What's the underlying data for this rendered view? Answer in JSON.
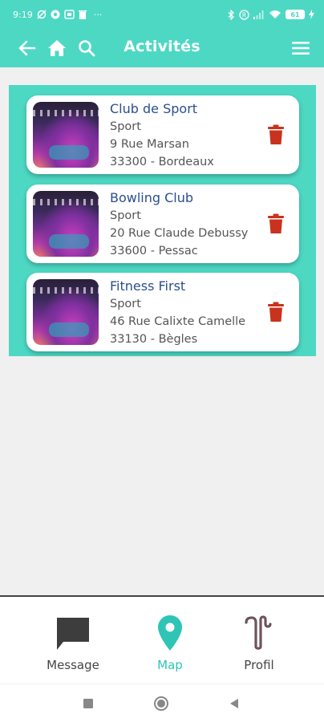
{
  "status": {
    "time": "9:19",
    "dots": "···",
    "battery": "61"
  },
  "appbar": {
    "title": "Activités",
    "back_icon": "back-arrow-icon",
    "home_icon": "home-icon",
    "search_icon": "search-icon",
    "menu_icon": "hamburger-menu-icon"
  },
  "activities": [
    {
      "name": "Club de Sport",
      "category": "Sport",
      "street": "9 Rue Marsan",
      "city": "33300 - Bordeaux"
    },
    {
      "name": "Bowling Club",
      "category": "Sport",
      "street": "20 Rue Claude Debussy",
      "city": "33600 - Pessac"
    },
    {
      "name": "Fitness First",
      "category": "Sport",
      "street": "46 Rue Calixte Camelle",
      "city": "33130 - Bègles"
    }
  ],
  "bottom_nav": {
    "items": [
      {
        "label": "Message",
        "icon": "message-bubble-icon"
      },
      {
        "label": "Map",
        "icon": "map-pin-icon",
        "active": true
      },
      {
        "label": "Profil",
        "icon": "profile-glyph-icon"
      }
    ]
  },
  "colors": {
    "accent": "#4dd8c4",
    "active_nav": "#2ec4b6",
    "title_text": "#2b4f8c",
    "delete": "#c9321c"
  }
}
